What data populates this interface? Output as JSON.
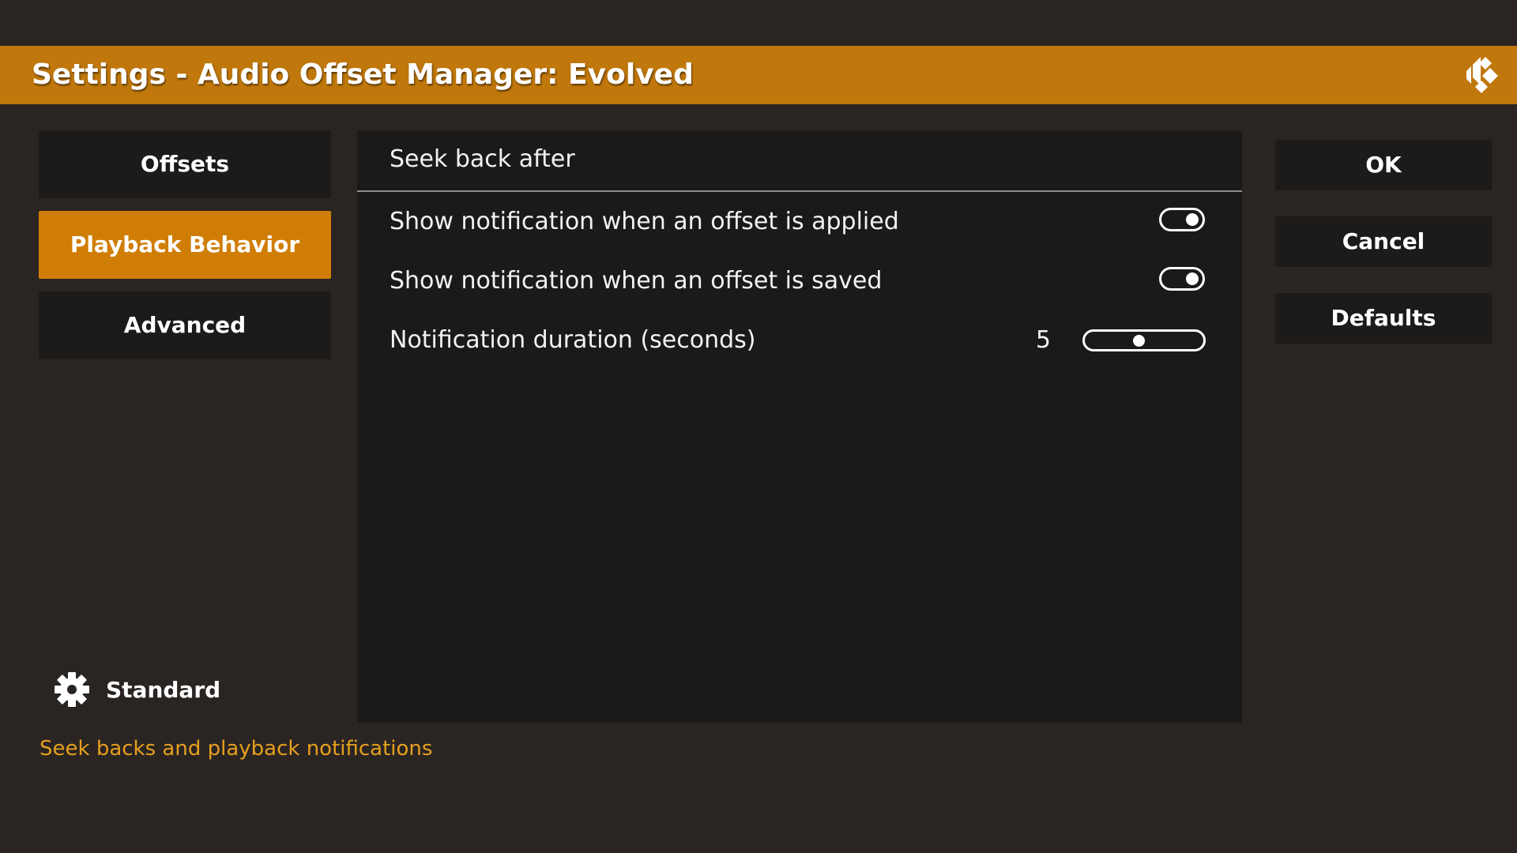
{
  "window": {
    "title": "Settings - Audio Offset Manager: Evolved"
  },
  "categories": [
    {
      "label": "Offsets"
    },
    {
      "label": "Playback Behavior"
    },
    {
      "label": "Advanced"
    }
  ],
  "settings_level": {
    "label": "Standard",
    "icon": "gear-icon"
  },
  "description": "Seek backs and playback notifications",
  "panel": {
    "section_title": "Seek back after",
    "settings": [
      {
        "label": "Show notification when an offset is applied",
        "type": "toggle",
        "enabled": true
      },
      {
        "label": "Show notification when an offset is saved",
        "type": "toggle",
        "enabled": true
      },
      {
        "label": "Notification duration (seconds)",
        "type": "slider",
        "value": "5",
        "position_fraction": 0.45
      }
    ]
  },
  "actions": {
    "ok_label": "OK",
    "cancel_label": "Cancel",
    "defaults_label": "Defaults"
  },
  "colors": {
    "accent": "#c0770b",
    "active_category": "#d07d05",
    "description_text": "#e69f1e",
    "background": "#2a2522",
    "panel": "#1b1a18"
  }
}
